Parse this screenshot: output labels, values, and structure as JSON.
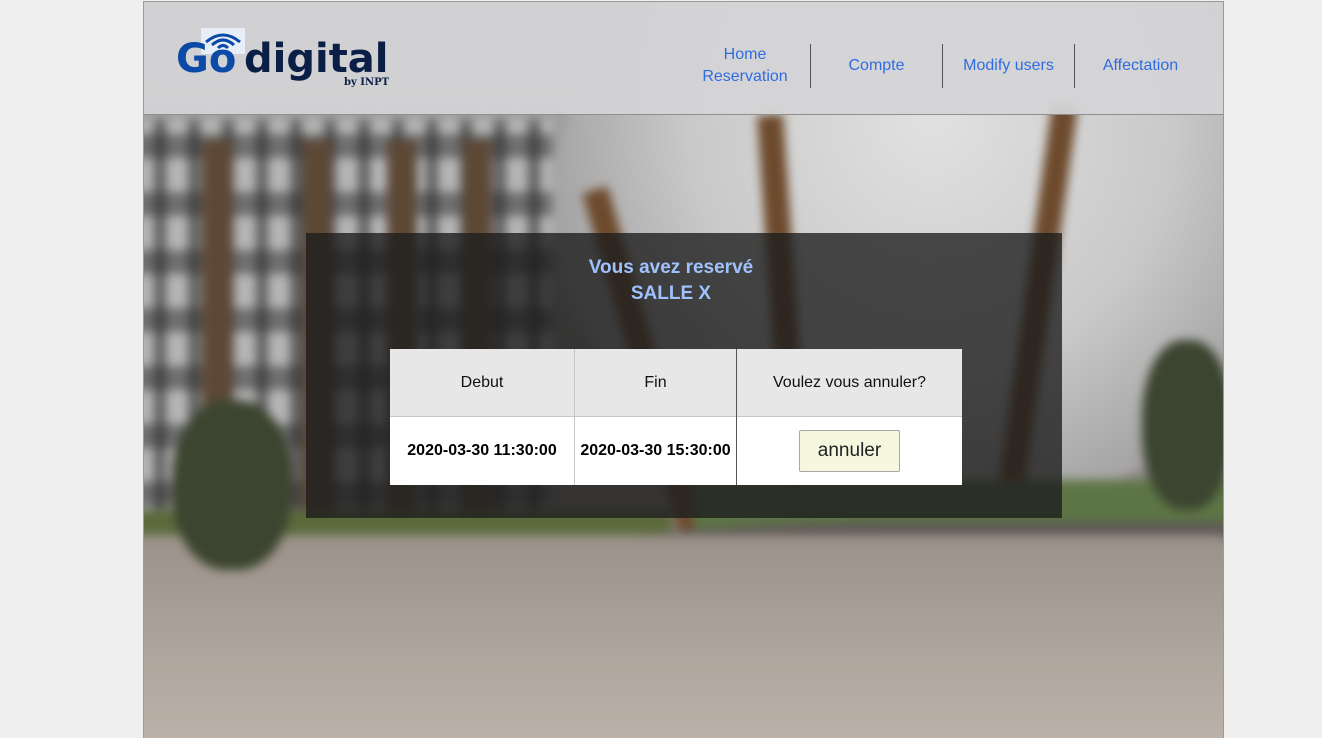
{
  "brand": {
    "logo_main_go": "Go",
    "logo_main_digital": "digital",
    "logo_sub": "by INPT"
  },
  "nav": {
    "items": [
      {
        "label": "Home Reservation"
      },
      {
        "label": "Compte"
      },
      {
        "label": "Modify users"
      },
      {
        "label": "Affectation"
      }
    ]
  },
  "reservation": {
    "title_line1": "Vous avez reservé",
    "title_line2": "SALLE X",
    "columns": [
      "Debut",
      "Fin",
      "Voulez vous annuler?"
    ],
    "row": {
      "debut": "2020-03-30 11:30:00",
      "fin": "2020-03-30 15:30:00"
    },
    "cancel_label": "annuler"
  },
  "colors": {
    "nav_link": "#2f6ce0",
    "title": "#9fc2ff",
    "logo_blue": "#0b4aa6",
    "logo_dark": "#0b1e46",
    "button_bg": "#f5f8df"
  }
}
